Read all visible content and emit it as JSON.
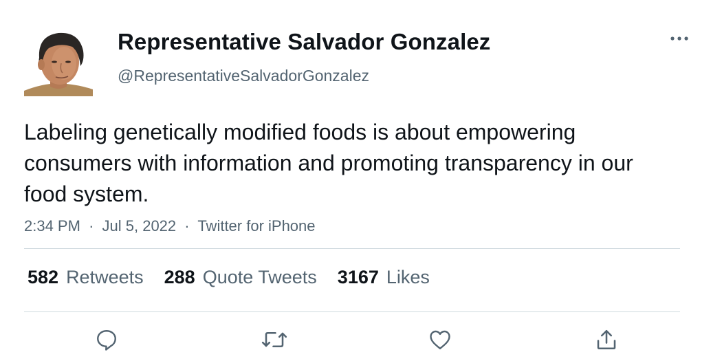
{
  "tweet": {
    "author": {
      "display_name": "Representative Salvador Gonzalez",
      "handle": "@RepresentativeSalvadorGonzalez",
      "avatar_icon": "profile-photo"
    },
    "text": "Labeling genetically modified foods is about empowering consumers with information and promoting transparency in our food system.",
    "time": "2:34 PM",
    "date": "Jul 5, 2022",
    "source": "Twitter for iPhone",
    "separator": "·",
    "stats": {
      "retweets": {
        "count": "582",
        "label": "Retweets"
      },
      "quote_tweets": {
        "count": "288",
        "label": "Quote Tweets"
      },
      "likes": {
        "count": "3167",
        "label": "Likes"
      }
    },
    "actions": {
      "reply_icon": "speech-bubble-icon",
      "retweet_icon": "retweet-arrows-icon",
      "like_icon": "heart-icon",
      "share_icon": "share-upload-icon"
    },
    "more_icon": "ellipsis-icon"
  },
  "colors": {
    "primary_text": "#0f1419",
    "secondary_text": "#536471",
    "divider": "#cfd9de",
    "icon": "#536471"
  }
}
